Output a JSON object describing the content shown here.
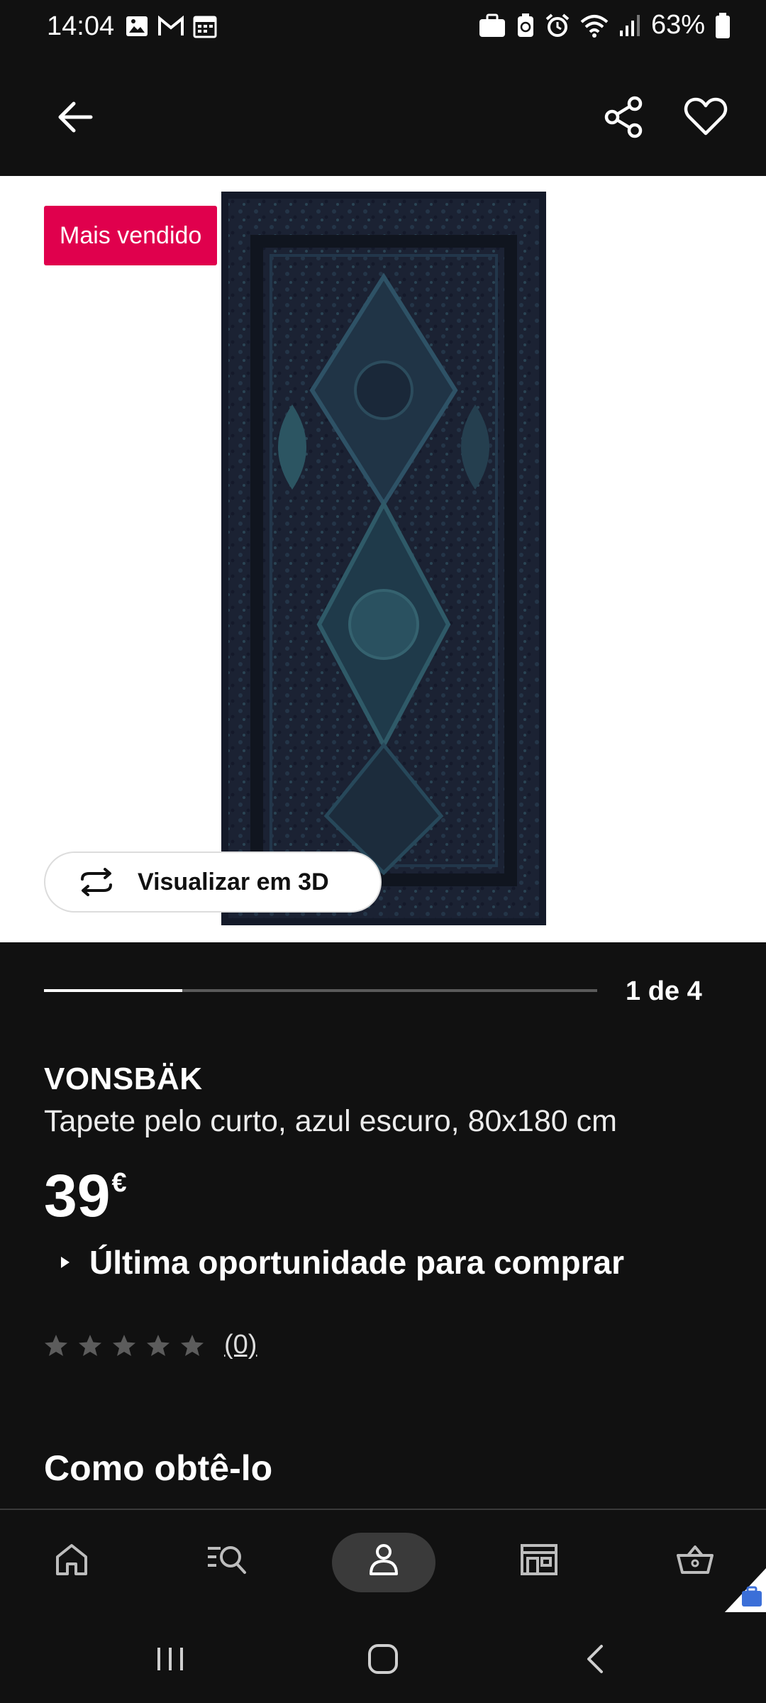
{
  "status_bar": {
    "time": "14:04",
    "battery": "63%"
  },
  "app_bar": {
    "back_icon": "arrow-left-icon",
    "share_icon": "share-icon",
    "favorite_icon": "heart-icon"
  },
  "product_image": {
    "badge": "Mais vendido",
    "view_3d_label": "Visualizar em 3D"
  },
  "carousel": {
    "progress": 0.25,
    "counter": "1 de 4"
  },
  "product": {
    "name": "VONSBÄK",
    "description": "Tapete pelo curto, azul escuro, 80x180 cm",
    "price_integer": "39",
    "price_currency": "€",
    "notice": "Última oportunidade para comprar",
    "rating_stars": 0,
    "rating_count": "(0)"
  },
  "sections": {
    "how_to_get": "Como obtê-lo"
  },
  "bottom_nav": {
    "items": [
      "home-icon",
      "search-icon",
      "profile-icon",
      "store-icon",
      "cart-icon"
    ],
    "active": "profile-icon"
  },
  "colors": {
    "badge": "#e0004d",
    "background": "#111111",
    "rug": "#1b2233"
  }
}
